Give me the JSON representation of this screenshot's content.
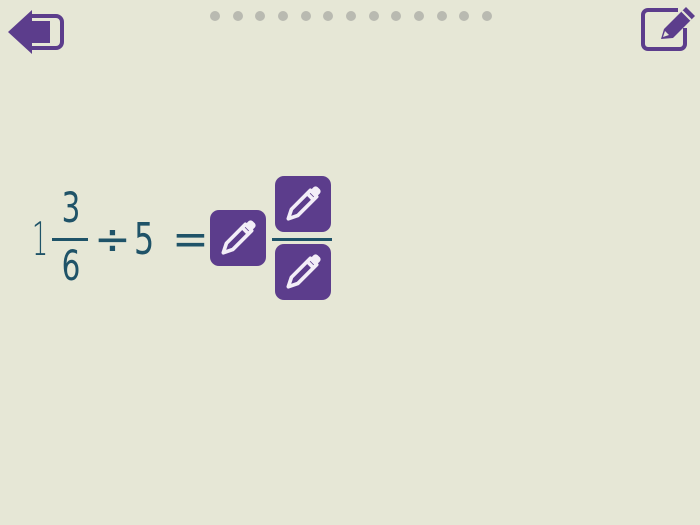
{
  "nav": {
    "back_icon": "back-arrow-icon",
    "scratchpad_icon": "pencil-edit-icon",
    "progress_dots": 13
  },
  "problem": {
    "whole": "1",
    "numerator": "3",
    "denominator": "6",
    "operator": "÷",
    "divisor": "5",
    "equals": "="
  },
  "answer": {
    "whole_icon": "pencil-icon",
    "numerator_icon": "pencil-icon",
    "denominator_icon": "pencil-icon"
  },
  "colors": {
    "background": "#e6e7d6",
    "accent": "#5c3d8c",
    "text": "#1f5368",
    "dot": "#b9bab1"
  }
}
